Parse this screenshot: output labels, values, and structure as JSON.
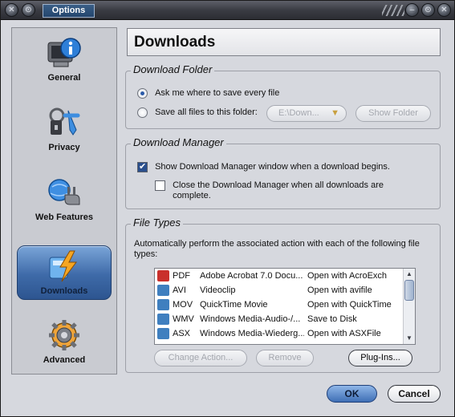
{
  "window": {
    "title": "Options"
  },
  "sidebar": {
    "items": [
      {
        "label": "General",
        "icon": "general-monitor-icon"
      },
      {
        "label": "Privacy",
        "icon": "privacy-keys-icon"
      },
      {
        "label": "Web Features",
        "icon": "web-features-plug-icon"
      },
      {
        "label": "Downloads",
        "icon": "downloads-bolt-icon",
        "active": true
      },
      {
        "label": "Advanced",
        "icon": "advanced-gear-icon"
      }
    ]
  },
  "page": {
    "title": "Downloads"
  },
  "download_folder": {
    "legend": "Download Folder",
    "ask_label": "Ask me where to save every file",
    "ask_selected": true,
    "save_all_label": "Save all files to this folder:",
    "save_all_selected": false,
    "folder_value": "E:\\Down...",
    "show_folder_label": "Show Folder"
  },
  "download_manager": {
    "legend": "Download Manager",
    "show_label": "Show Download Manager window when a download begins.",
    "show_checked": true,
    "close_label_line1": "Close the Download Manager when all downloads are",
    "close_label_line2": "complete.",
    "close_checked": false
  },
  "file_types": {
    "legend": "File Types",
    "description_line1": "Automatically perform the associated action with each of the following file",
    "description_line2": "types:",
    "rows": [
      {
        "ext": "PDF",
        "name": "Adobe Acrobat 7.0 Docu...",
        "action": "Open with AcroExch",
        "icon_color": "#c9302c"
      },
      {
        "ext": "AVI",
        "name": "Videoclip",
        "action": "Open with avifile",
        "icon_color": "#3f7fbf"
      },
      {
        "ext": "MOV",
        "name": "QuickTime Movie",
        "action": "Open with QuickTime",
        "icon_color": "#3f7fbf"
      },
      {
        "ext": "WMV",
        "name": "Windows Media-Audio-/...",
        "action": "Save to Disk",
        "icon_color": "#3f7fbf"
      },
      {
        "ext": "ASX",
        "name": "Windows Media-Wiederg...",
        "action": "Open with ASXFile",
        "icon_color": "#3f7fbf"
      }
    ],
    "change_action_label": "Change Action...",
    "remove_label": "Remove",
    "plugins_label": "Plug-Ins..."
  },
  "footer": {
    "ok_label": "OK",
    "cancel_label": "Cancel"
  },
  "colors": {
    "accent": "#2d5590",
    "window_bg": "#d6d8de"
  }
}
